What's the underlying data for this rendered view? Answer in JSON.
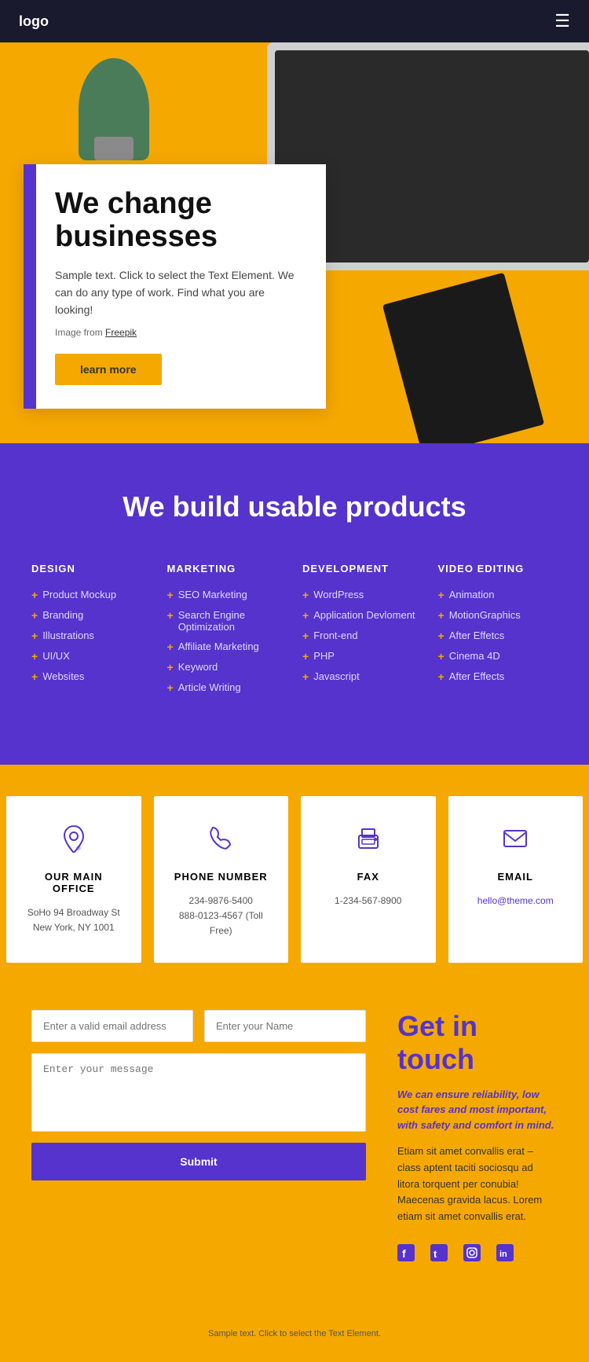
{
  "nav": {
    "logo": "logo",
    "menu_icon": "☰"
  },
  "hero": {
    "title_line1": "We change",
    "title_line2": "businesses",
    "description": "Sample text. Click to select the Text Element. We can do any type of work. Find what you are looking!",
    "image_credit_prefix": "Image from ",
    "image_credit_link": "Freepik",
    "cta_label": "learn more"
  },
  "products": {
    "section_title": "We build usable products",
    "columns": [
      {
        "title": "DESIGN",
        "items": [
          "Product Mockup",
          "Branding",
          "Illustrations",
          "UI/UX",
          "Websites"
        ]
      },
      {
        "title": "MARKETING",
        "items": [
          "SEO Marketing",
          "Search Engine Optimization",
          "Affiliate Marketing",
          "Keyword",
          "Article Writing"
        ]
      },
      {
        "title": "DEVELOPMENT",
        "items": [
          "WordPress",
          "Application Devloment",
          "Front-end",
          "PHP",
          "Javascript"
        ]
      },
      {
        "title": "VIDEO EDITING",
        "items": [
          "Animation",
          "MotionGraphics",
          "After Effetcs",
          "Cinema 4D",
          "After Effects"
        ]
      }
    ]
  },
  "contact_cards": [
    {
      "id": "office",
      "title": "OUR MAIN OFFICE",
      "detail": "SoHo 94 Broadway St New York, NY 1001"
    },
    {
      "id": "phone",
      "title": "PHONE NUMBER",
      "detail": "234-9876-5400\n888-0123-4567 (Toll Free)"
    },
    {
      "id": "fax",
      "title": "FAX",
      "detail": "1-234-567-8900"
    },
    {
      "id": "email",
      "title": "EMAIL",
      "detail": "hello@theme.com",
      "is_link": true
    }
  ],
  "contact_form": {
    "email_placeholder": "Enter a valid email address",
    "name_placeholder": "Enter your Name",
    "message_placeholder": "Enter your message",
    "submit_label": "Submit"
  },
  "get_in_touch": {
    "title": "Get in touch",
    "subtitle": "We can ensure reliability, low cost fares and most important, with safety and comfort in mind.",
    "description": "Etiam sit amet convallis erat – class aptent taciti sociosqu ad litora torquent per conubia! Maecenas gravida lacus. Lorem etiam sit amet convallis erat.",
    "social": [
      "f",
      "t",
      "in-icon",
      "li"
    ]
  },
  "footer": {
    "text": "Sample text. Click to select the Text Element."
  }
}
